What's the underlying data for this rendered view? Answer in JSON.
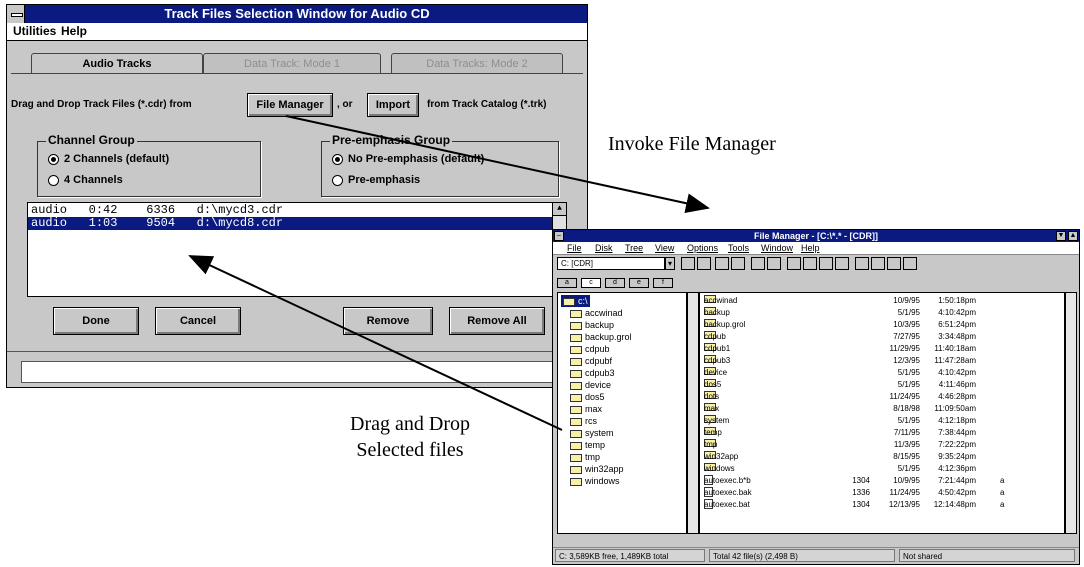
{
  "track_window": {
    "title": "Track Files Selection Window for Audio CD",
    "menu": [
      "Utilities",
      "Help"
    ],
    "tabs": [
      "Audio Tracks",
      "Data Track: Mode 1",
      "Data Tracks: Mode 2"
    ],
    "instruction_prefix": "Drag and Drop Track Files (*.cdr) from",
    "file_manager_button": "File Manager",
    "or_text": ", or",
    "import_button": "Import",
    "instruction_suffix": "from Track Catalog (*.trk)",
    "channel_group": {
      "title": "Channel Group",
      "options": [
        "2 Channels (default)",
        "4 Channels"
      ],
      "selected_index": 0
    },
    "preemphasis_group": {
      "title": "Pre-emphasis Group",
      "options": [
        "No Pre-emphasis (default)",
        "Pre-emphasis"
      ],
      "selected_index": 0
    },
    "tracks": [
      {
        "type": "audio",
        "time": "0:42",
        "size": "6336",
        "path": "d:\\mycd3.cdr"
      },
      {
        "type": "audio",
        "time": "1:03",
        "size": "9504",
        "path": "d:\\mycd8.cdr"
      }
    ],
    "selected_track_index": 1,
    "buttons": {
      "done": "Done",
      "cancel": "Cancel",
      "remove": "Remove",
      "remove_all": "Remove All"
    }
  },
  "file_manager": {
    "title": "File Manager - [C:\\*.* - [CDR]]",
    "menu": [
      "File",
      "Disk",
      "Tree",
      "View",
      "Options",
      "Tools",
      "Window",
      "Help"
    ],
    "drive_select": "C: [CDR]",
    "tree_root": "c:\\",
    "tree": [
      "accwinad",
      "backup",
      "backup.grol",
      "cdpub",
      "cdpubf",
      "cdpub3",
      "device",
      "dos5",
      "max",
      "rcs",
      "system",
      "temp",
      "tmp",
      "win32app",
      "windows"
    ],
    "files": [
      {
        "name": "accwinad",
        "size": "",
        "date": "10/9/95",
        "time": "1:50:18pm",
        "attr": ""
      },
      {
        "name": "backup",
        "size": "",
        "date": "5/1/95",
        "time": "4:10:42pm",
        "attr": ""
      },
      {
        "name": "backup.grol",
        "size": "",
        "date": "10/3/95",
        "time": "6:51:24pm",
        "attr": ""
      },
      {
        "name": "cdpub",
        "size": "",
        "date": "7/27/95",
        "time": "3:34:48pm",
        "attr": ""
      },
      {
        "name": "cdpub1",
        "size": "",
        "date": "11/29/95",
        "time": "11:40:18am",
        "attr": ""
      },
      {
        "name": "cdpub3",
        "size": "",
        "date": "12/3/95",
        "time": "11:47:28am",
        "attr": ""
      },
      {
        "name": "device",
        "size": "",
        "date": "5/1/95",
        "time": "4:10:42pm",
        "attr": ""
      },
      {
        "name": "dos5",
        "size": "",
        "date": "5/1/95",
        "time": "4:11:46pm",
        "attr": ""
      },
      {
        "name": "dots",
        "size": "",
        "date": "11/24/95",
        "time": "4:46:28pm",
        "attr": ""
      },
      {
        "name": "max",
        "size": "",
        "date": "8/18/98",
        "time": "11:09:50am",
        "attr": ""
      },
      {
        "name": "system",
        "size": "",
        "date": "5/1/95",
        "time": "4:12:18pm",
        "attr": ""
      },
      {
        "name": "temp",
        "size": "",
        "date": "7/11/95",
        "time": "7:38:44pm",
        "attr": ""
      },
      {
        "name": "tmp",
        "size": "",
        "date": "11/3/95",
        "time": "7:22:22pm",
        "attr": ""
      },
      {
        "name": "win32app",
        "size": "",
        "date": "8/15/95",
        "time": "9:35:24pm",
        "attr": ""
      },
      {
        "name": "windows",
        "size": "",
        "date": "5/1/95",
        "time": "4:12:36pm",
        "attr": ""
      },
      {
        "name": "autoexec.b*b",
        "size": "1304",
        "date": "10/9/95",
        "time": "7:21:44pm",
        "attr": "a"
      },
      {
        "name": "autoexec.bak",
        "size": "1336",
        "date": "11/24/95",
        "time": "4:50:42pm",
        "attr": "a"
      },
      {
        "name": "autoexec.bat",
        "size": "1304",
        "date": "12/13/95",
        "time": "12:14:48pm",
        "attr": "a"
      }
    ],
    "status": {
      "free": "C: 3,589KB free, 1,489KB total",
      "total": "Total 42 file(s) (2,498 B)",
      "shared": "Not shared"
    }
  },
  "annotations": {
    "invoke": "Invoke File Manager",
    "drag_line1": "Drag and Drop",
    "drag_line2": "Selected files"
  }
}
